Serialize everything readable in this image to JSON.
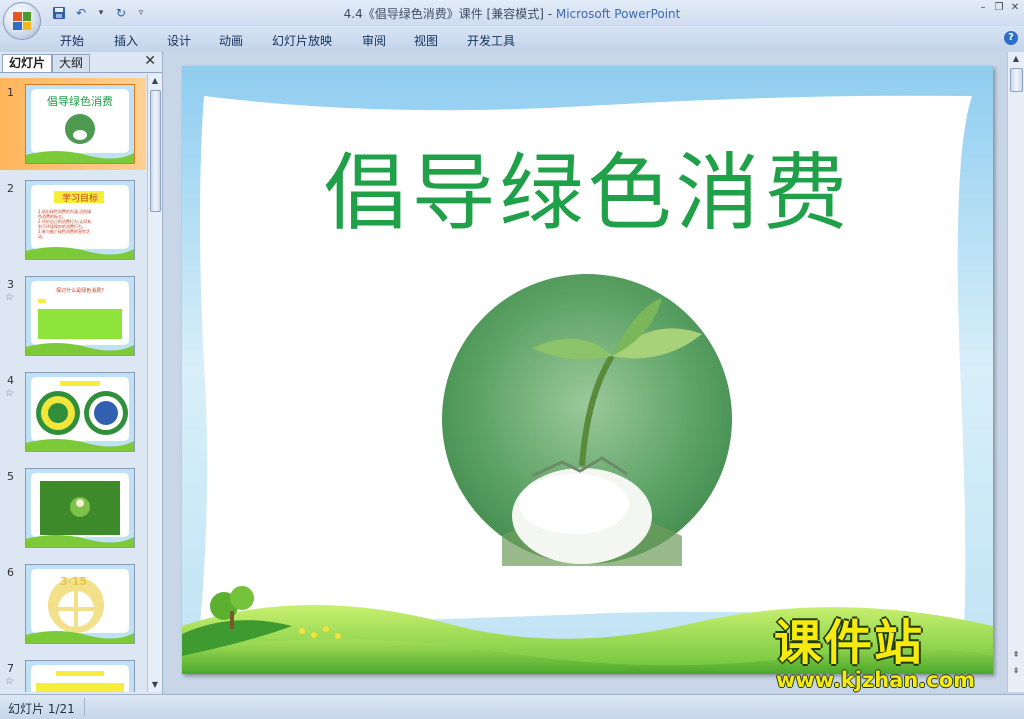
{
  "window": {
    "title": "4.4《倡导绿色消费》课件 [兼容模式]",
    "separator": " - ",
    "app_name": "Microsoft PowerPoint"
  },
  "ribbon": {
    "tabs": [
      "开始",
      "插入",
      "设计",
      "动画",
      "幻灯片放映",
      "审阅",
      "视图",
      "开发工具"
    ],
    "help_label": "?"
  },
  "panel": {
    "tab_slides": "幻灯片",
    "tab_outline": "大纲",
    "close_label": "✕"
  },
  "thumbnails": [
    {
      "num": "1",
      "title": "倡导绿色消费"
    },
    {
      "num": "2",
      "title": "学习目标",
      "lines": [
        "1.说出绿色消费的内涵,识别绿",
        "色消费的标志。",
        "2.评价自己的消费行为,认同有",
        "利于环境保护的消费行为。",
        "3.参与推广绿色消费的宣传活",
        "动。"
      ]
    },
    {
      "num": "3",
      "title": "探讨什么是绿色消费?"
    },
    {
      "num": "4",
      "title": ""
    },
    {
      "num": "5"
    },
    {
      "num": "6",
      "logo_text": "3·15"
    },
    {
      "num": "7"
    }
  ],
  "slide": {
    "title": "倡导绿色消费"
  },
  "status": {
    "slide_info": "幻灯片 1/21"
  },
  "watermark": {
    "brand": "课件站",
    "url": "www.kjzhan.com"
  },
  "colors": {
    "title_green": "#21a04a",
    "selected_thumb": "#ffb55a",
    "watermark_yellow": "#f6ea10"
  }
}
